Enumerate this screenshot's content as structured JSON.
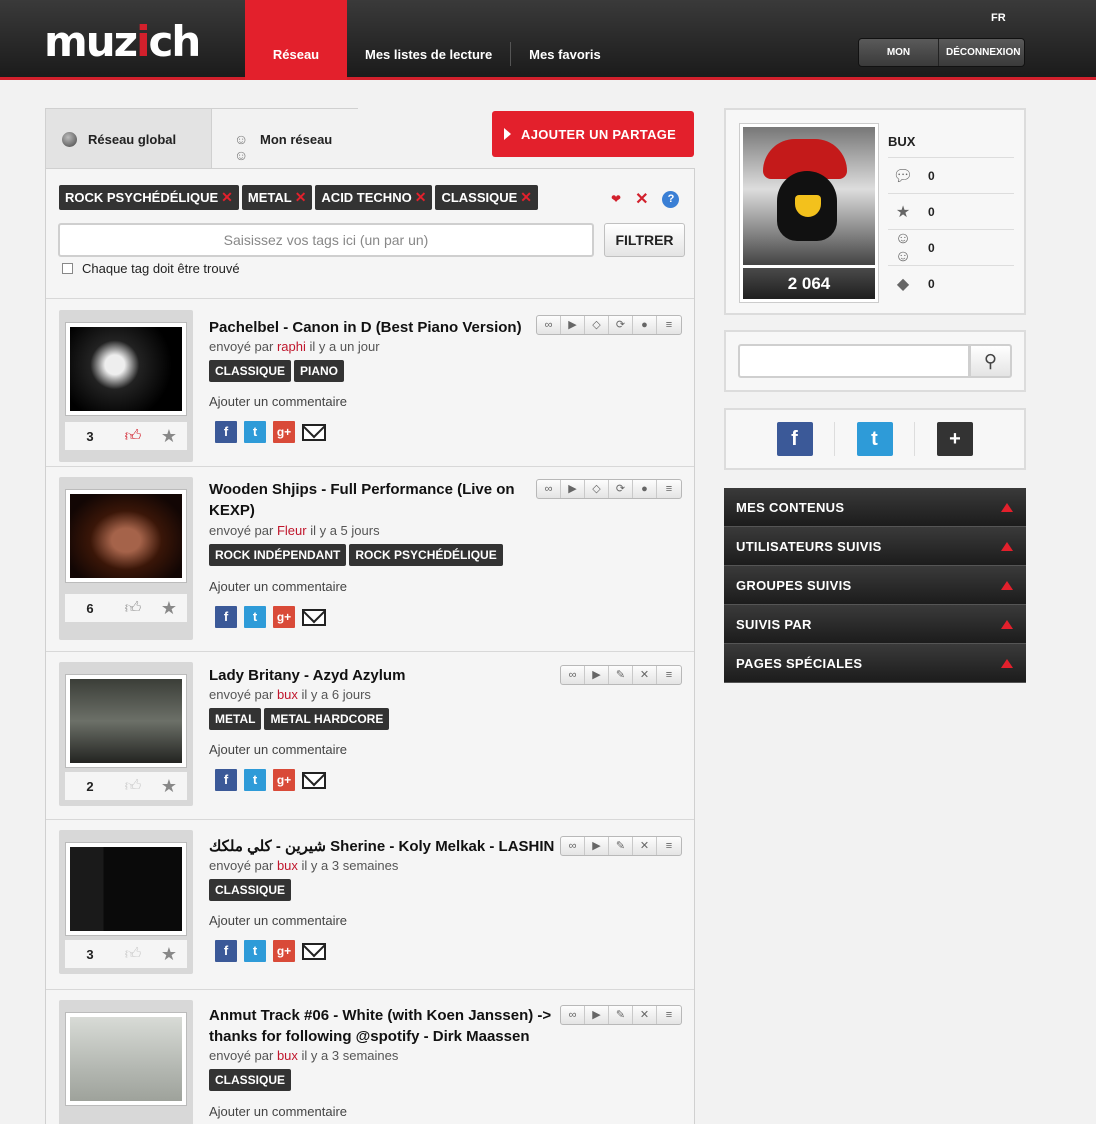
{
  "header": {
    "logo": "muzich",
    "nav": [
      "Réseau",
      "Mes listes de lecture",
      "Mes favoris"
    ],
    "lang": "FR",
    "account": "MON COMPTE",
    "logout": "DÉCONNEXION"
  },
  "tabs": {
    "global": "Réseau global",
    "mine": "Mon réseau"
  },
  "add_button": "AJOUTER UN PARTAGE",
  "filters": {
    "tags": [
      "ROCK PSYCHÉDÉLIQUE",
      "METAL",
      "ACID TECHNO",
      "CLASSIQUE"
    ],
    "input_placeholder": "Saisissez vos tags ici (un par un)",
    "filter_button": "FILTRER",
    "checkbox_label": "Chaque tag doit être trouvé"
  },
  "feed": [
    {
      "title": "Pachelbel - Canon in D (Best Piano Version)",
      "by_prefix": "envoyé par",
      "user": "raphi",
      "when": "il y a un jour",
      "tags": [
        "CLASSIQUE",
        "PIANO"
      ],
      "count": "3",
      "comment": "Ajouter un commentaire"
    },
    {
      "title": "Wooden Shjips - Full Performance (Live on KEXP)",
      "by_prefix": "envoyé par",
      "user": "Fleur",
      "when": "il y a 5 jours",
      "tags": [
        "ROCK INDÉPENDANT",
        "ROCK PSYCHÉDÉLIQUE"
      ],
      "count": "6",
      "comment": "Ajouter un commentaire"
    },
    {
      "title": "Lady Britany - Azyd Azylum",
      "by_prefix": "envoyé par",
      "user": "bux",
      "when": "il y a 6 jours",
      "tags": [
        "METAL",
        "METAL HARDCORE"
      ],
      "count": "2",
      "comment": "Ajouter un commentaire"
    },
    {
      "title": "شيرين - كلي ملكك Sherine - Koly Melkak - LASHIN RT,",
      "by_prefix": "envoyé par",
      "user": "bux",
      "when": "il y a 3 semaines",
      "tags": [
        "CLASSIQUE"
      ],
      "count": "3",
      "comment": "Ajouter un commentaire"
    },
    {
      "title": "Anmut Track #06 - White (with Koen Janssen) -> thanks for following @spotify - Dirk Maassen",
      "by_prefix": "envoyé par",
      "user": "bux",
      "when": "il y a 3 semaines",
      "tags": [
        "CLASSIQUE"
      ],
      "count": "",
      "comment": "Ajouter un commentaire"
    }
  ],
  "profile": {
    "username": "BUX",
    "score": "2 064",
    "stats": [
      "0",
      "0",
      "0",
      "0"
    ]
  },
  "menu": [
    "MES CONTENUS",
    "UTILISATEURS SUIVIS",
    "GROUPES SUIVIS",
    "SUIVIS PAR",
    "PAGES SPÉCIALES"
  ],
  "colors": {
    "accent": "#e3202c",
    "dark": "#1f1f1f"
  }
}
